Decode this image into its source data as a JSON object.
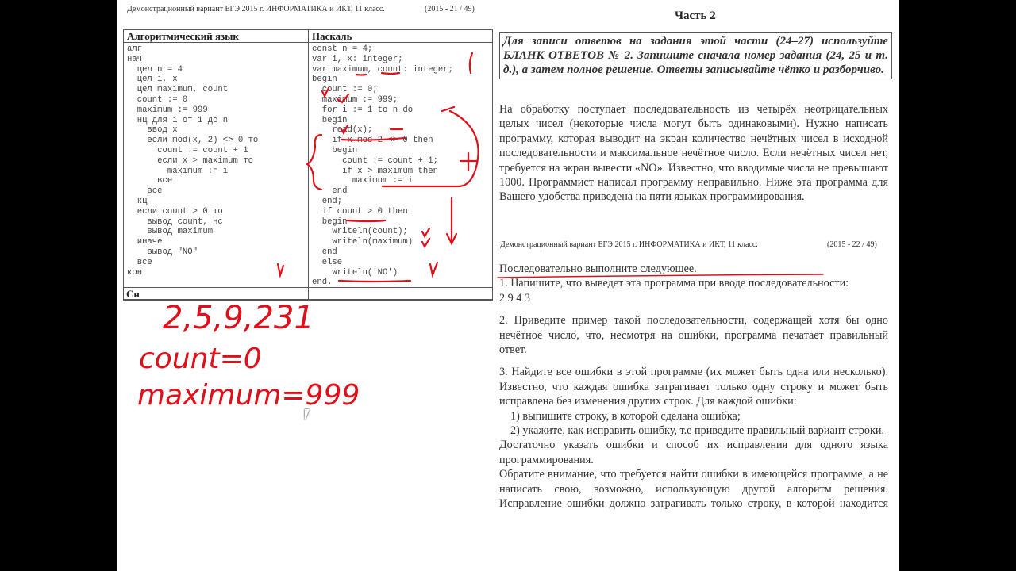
{
  "left_page": {
    "header": "Демонстрационный вариант ЕГЭ 2015 г. ИНФОРМАТИКА и ИКТ, 11 класс.",
    "page_num": "(2015 - 21 / 49)",
    "col1_title": "Алгоритмический язык",
    "col2_title": "Паскаль",
    "alg_code": [
      "алг",
      "нач",
      "  цел n = 4",
      "  цел i, x",
      "  цел maximum, count",
      "  count := 0",
      "  maximum := 999",
      "  нц для i от 1 до n",
      "    ввод x",
      "    если mod(x, 2) <> 0 то",
      "      count := count + 1",
      "      если x > maximum то",
      "        maximum := i",
      "      все",
      "    все",
      "  кц",
      "  если count > 0 то",
      "    вывод count, нс",
      "    вывод maximum",
      "  иначе",
      "    вывод \"NO\"",
      "  все",
      "кон"
    ],
    "pascal_code": [
      "const n = 4;",
      "var i, x: integer;",
      "var maximum, count: integer;",
      "begin",
      "  count := 0;",
      "  maximum := 999;",
      "  for i := 1 to n do",
      "  begin",
      "    read(x);",
      "    if x mod 2 <> 0 then",
      "    begin",
      "      count := count + 1;",
      "      if x > maximum then",
      "        maximum := i",
      "    end",
      "  end;",
      "  if count > 0 then",
      "  begin",
      "    writeln(count);",
      "    writeln(maximum)",
      "  end",
      "  else",
      "    writeln('NO')",
      "end."
    ],
    "next_section": "Си"
  },
  "handwriting": [
    "2,5,9,231",
    "count=0",
    "maximum=999"
  ],
  "right_page": {
    "part_title": "Часть 2",
    "instructions": "Для записи ответов на задания этой части (24–27) используйте БЛАНК ОТВЕТОВ № 2. Запишите сначала номер задания (24, 25 и т. д.), а затем полное решение. Ответы записывайте чётко и разборчиво.",
    "task": "На обработку поступает последовательность из четырёх неотрицательных целых чисел (некоторые числа могут быть одинаковыми). Нужно написать программу, которая выводит на экран количество нечётных чисел в исходной последовательности и максимальное нечётное число. Если нечётных чисел нет, требуется на экран вывести «NO». Известно, что вводимые числа не превышают 1000. Программист написал программу неправильно. Ниже эта программа для Вашего удобства приведена на пяти языках программирования.",
    "header2": "Демонстрационный вариант ЕГЭ 2015 г. ИНФОРМАТИКА и ИКТ, 11 класс.",
    "page_num2": "(2015 - 22 / 49)",
    "lead": "Последовательно выполните следующее.",
    "q1": "1. Напишите, что выведет эта программа при вводе последовательности:",
    "q1_seq": "2 9 4 3",
    "q2": "2. Приведите пример такой последовательности, содержащей хотя бы одно нечётное число, что, несмотря на ошибки, программа печатает правильный ответ.",
    "q3": "3. Найдите все ошибки в этой программе (их может быть одна или несколько). Известно, что каждая ошибка затрагивает только одну строку и может быть исправлена без изменения других строк. Для каждой ошибки:",
    "q3_1": "1) выпишите строку, в которой сделана ошибка;",
    "q3_2": "2) укажите, как исправить ошибку, т.е приведите правильный вариант строки.",
    "note1": "Достаточно указать ошибки и способ их исправления для одного языка программирования.",
    "note2": "Обратите внимание, что требуется найти ошибки в имеющейся программе, а не написать свою, возможно, использующую другой алгоритм решения. Исправление ошибки должно затрагивать только строку, в которой находится ошибка."
  },
  "colors": {
    "annotation": "#e0101a",
    "background": "#000000",
    "page": "#ffffff"
  }
}
